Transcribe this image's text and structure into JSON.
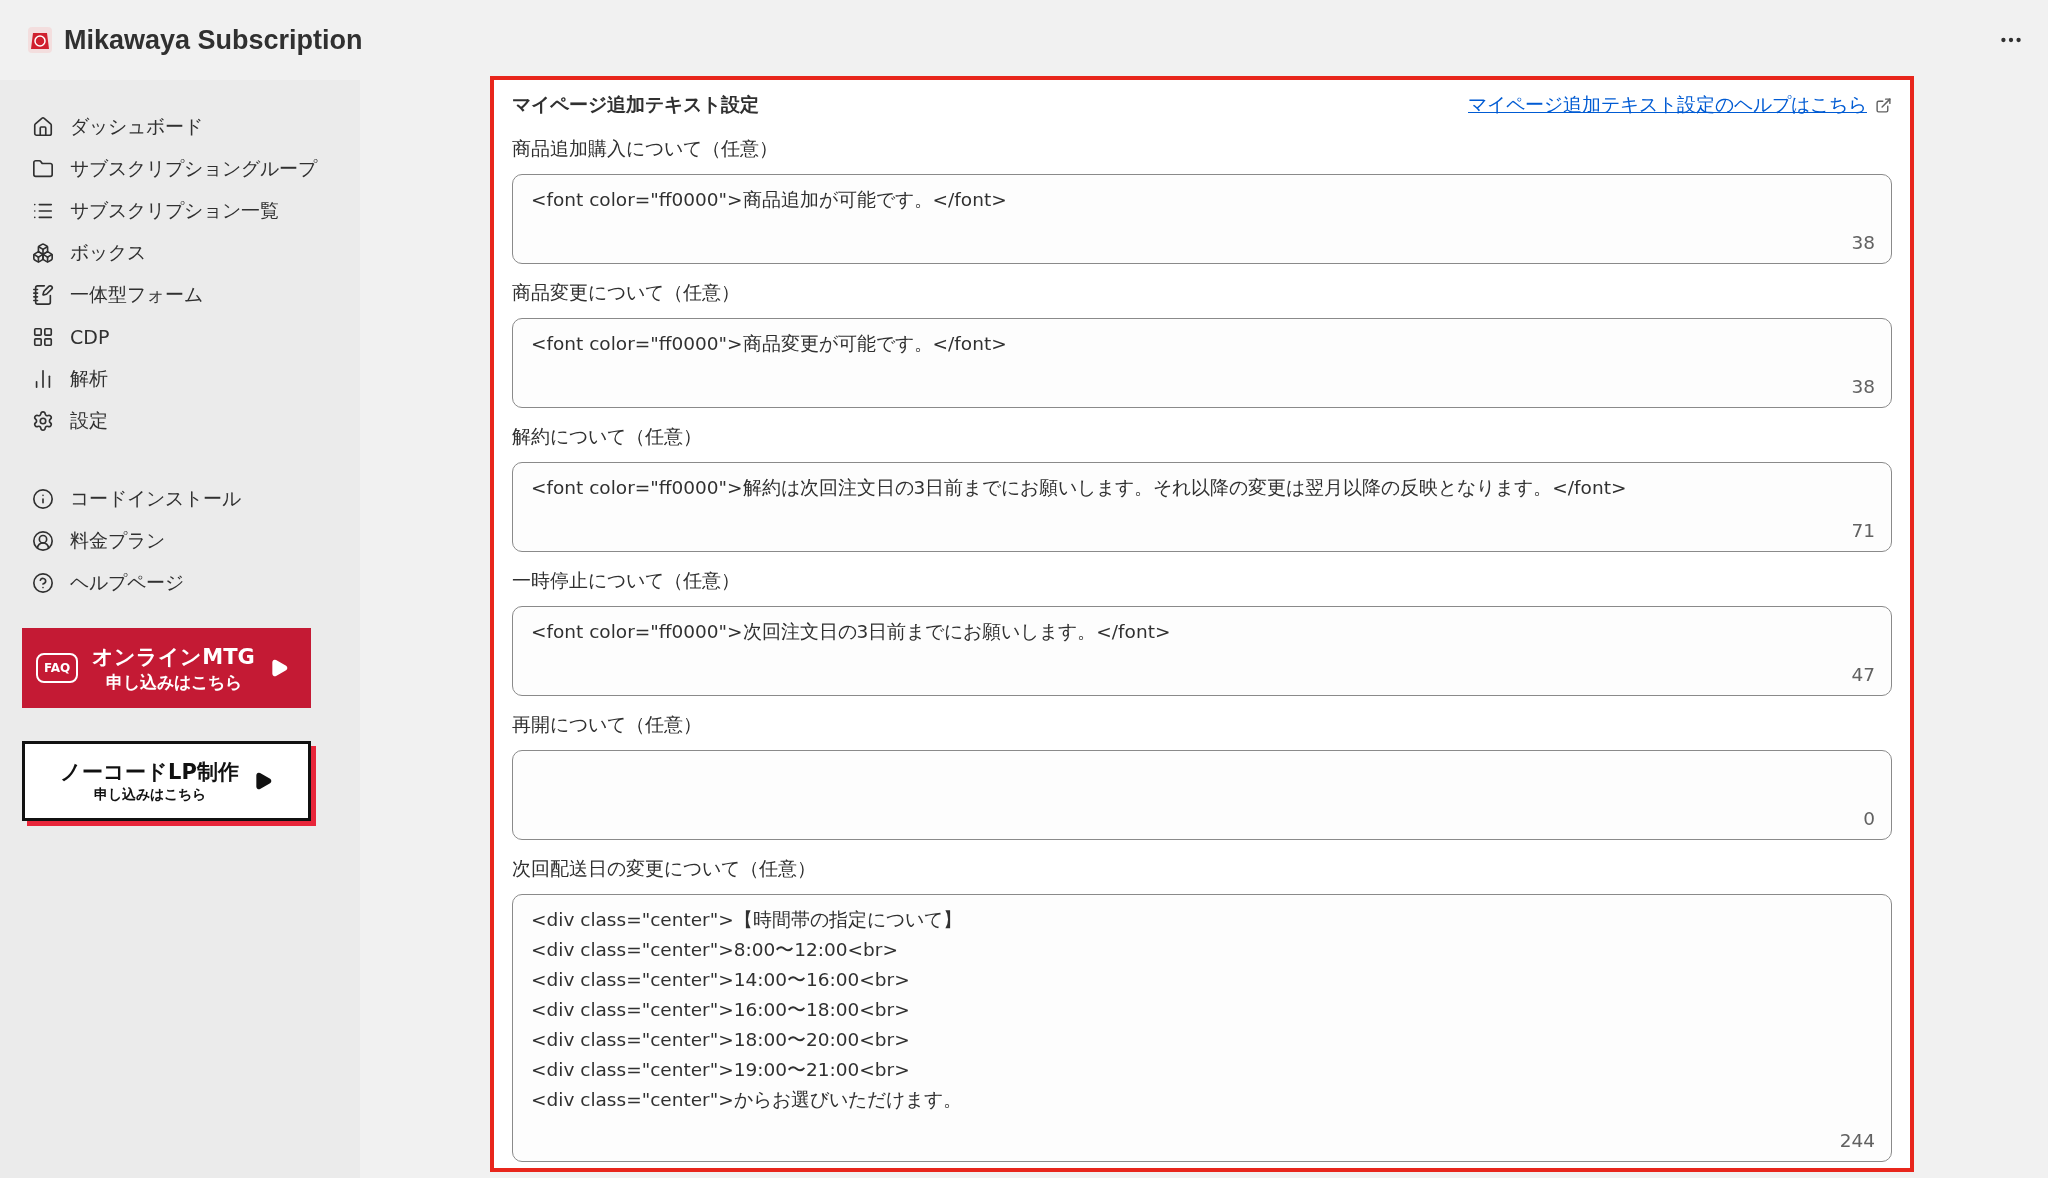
{
  "app": {
    "title": "Mikawaya Subscription"
  },
  "sidebar": {
    "items": [
      {
        "label": "ダッシュボード"
      },
      {
        "label": "サブスクリプショングループ"
      },
      {
        "label": "サブスクリプション一覧"
      },
      {
        "label": "ボックス"
      },
      {
        "label": "一体型フォーム"
      },
      {
        "label": "CDP"
      },
      {
        "label": "解析"
      },
      {
        "label": "設定"
      }
    ],
    "secondary_items": [
      {
        "label": "コードインストール"
      },
      {
        "label": "料金プラン"
      },
      {
        "label": "ヘルプページ"
      }
    ],
    "banners": [
      {
        "kind": "red",
        "badge": "FAQ",
        "title": "オンラインMTG",
        "subtitle": "申し込みはこちら"
      },
      {
        "kind": "outline",
        "title": "ノーコードLP制作",
        "subtitle": "申し込みはこちら"
      }
    ]
  },
  "card": {
    "title": "マイページ追加テキスト設定",
    "help_link": "マイページ追加テキスト設定のヘルプはこちら",
    "fields": [
      {
        "label": "商品追加購入について（任意）",
        "value": "<font color=\"ff0000\">商品追加が可能です。</font>",
        "count": "38"
      },
      {
        "label": "商品変更について（任意）",
        "value": "<font color=\"ff0000\">商品変更が可能です。</font>",
        "count": "38"
      },
      {
        "label": "解約について（任意）",
        "value": "<font color=\"ff0000\">解約は次回注文日の3日前までにお願いします。それ以降の変更は翌月以降の反映となります。</font>",
        "count": "71"
      },
      {
        "label": "一時停止について（任意）",
        "value": "<font color=\"ff0000\">次回注文日の3日前までにお願いします。</font>",
        "count": "47"
      },
      {
        "label": "再開について（任意）",
        "count": "0"
      },
      {
        "label": "次回配送日の変更について（任意）",
        "value": "<div class=\"center\">【時間帯の指定について】\n<div class=\"center\">8:00〜12:00<br>\n<div class=\"center\">14:00〜16:00<br>\n<div class=\"center\">16:00〜18:00<br>\n<div class=\"center\">18:00〜20:00<br>\n<div class=\"center\">19:00〜21:00<br>\n<div class=\"center\">からお選びいただけます。",
        "count": "244"
      }
    ]
  }
}
